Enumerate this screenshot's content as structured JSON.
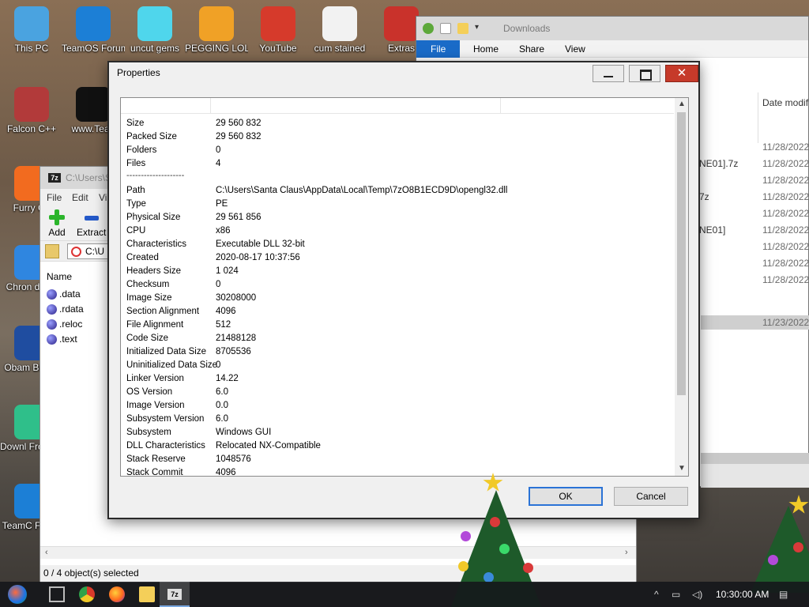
{
  "desktop": {
    "icons": [
      {
        "label": "This PC",
        "color": "#4aa3e0"
      },
      {
        "label": "TeamOS Forum Lin",
        "color": "#1c7fd6"
      },
      {
        "label": "uncut gems",
        "color": "#4fd6ec"
      },
      {
        "label": "PEGGING LOL",
        "color": "#f0a126"
      },
      {
        "label": "YouTube",
        "color": "#d63a2b"
      },
      {
        "label": "cum stained",
        "color": "#f2f2f2"
      },
      {
        "label": "Extras",
        "color": "#c9322b"
      },
      {
        "label": "Falcon C++",
        "color": "#b23a3a"
      },
      {
        "label": "www.Tean",
        "color": "#111111"
      },
      {
        "label": "Furry Co",
        "color": "#f26b1f"
      },
      {
        "label": "Chron disea",
        "color": "#2f86e0"
      },
      {
        "label": "Obam Brows",
        "color": "#1f4da0"
      },
      {
        "label": "Downl From tea",
        "color": "#2fbf8a"
      },
      {
        "label": "TeamC Faceb",
        "color": "#1c7fd6"
      }
    ]
  },
  "explorer": {
    "title": "Downloads",
    "tabs": [
      "File",
      "Home",
      "Share",
      "View"
    ],
    "column_header": "Date modif",
    "rows": [
      {
        "name": "",
        "date": "11/28/2022"
      },
      {
        "name": "NE01].7z",
        "date": "11/28/2022"
      },
      {
        "name": "",
        "date": "11/28/2022"
      },
      {
        "name": "7z",
        "date": "11/28/2022"
      },
      {
        "name": "",
        "date": "11/28/2022"
      },
      {
        "name": "NE01]",
        "date": "11/28/2022"
      },
      {
        "name": "",
        "date": "11/28/2022"
      },
      {
        "name": "",
        "date": "11/28/2022"
      },
      {
        "name": "",
        "date": "11/28/2022"
      },
      {
        "name": "",
        "date": "11/23/2022"
      }
    ]
  },
  "sevenzip": {
    "badge": "7z",
    "title_path": "C:\\Users\\S",
    "menu": [
      "File",
      "Edit",
      "Vi"
    ],
    "toolbar": {
      "add": "Add",
      "extract": "Extract"
    },
    "address": "C:\\U",
    "list_header": "Name",
    "files": [
      ".data",
      ".rdata",
      ".reloc",
      ".text"
    ],
    "status": "0 / 4 object(s) selected"
  },
  "dialog": {
    "title": "Properties",
    "close_glyph": "✕",
    "separator": "--------------------",
    "rows_top": [
      {
        "k": "Size",
        "v": "29 560 832"
      },
      {
        "k": "Packed Size",
        "v": "29 560 832"
      },
      {
        "k": "Folders",
        "v": "0"
      },
      {
        "k": "Files",
        "v": "4"
      }
    ],
    "rows": [
      {
        "k": "Path",
        "v": "C:\\Users\\Santa Claus\\AppData\\Local\\Temp\\7zO8B1ECD9D\\opengl32.dll"
      },
      {
        "k": "Type",
        "v": "PE"
      },
      {
        "k": "Physical Size",
        "v": "29 561 856"
      },
      {
        "k": "CPU",
        "v": "x86"
      },
      {
        "k": "Characteristics",
        "v": "Executable DLL 32-bit"
      },
      {
        "k": "Created",
        "v": "2020-08-17 10:37:56"
      },
      {
        "k": "Headers Size",
        "v": "1 024"
      },
      {
        "k": "Checksum",
        "v": "0"
      },
      {
        "k": "Image Size",
        "v": "30208000"
      },
      {
        "k": "Section Alignment",
        "v": "4096"
      },
      {
        "k": "File Alignment",
        "v": "512"
      },
      {
        "k": "Code Size",
        "v": "21488128"
      },
      {
        "k": "Initialized Data Size",
        "v": "8705536"
      },
      {
        "k": "Uninitialized Data Size",
        "v": "0"
      },
      {
        "k": "Linker Version",
        "v": "14.22"
      },
      {
        "k": "OS Version",
        "v": "6.0"
      },
      {
        "k": "Image Version",
        "v": "0.0"
      },
      {
        "k": "Subsystem Version",
        "v": "6.0"
      },
      {
        "k": "Subsystem",
        "v": "Windows GUI"
      },
      {
        "k": "DLL Characteristics",
        "v": "Relocated NX-Compatible"
      },
      {
        "k": "Stack Reserve",
        "v": "1048576"
      },
      {
        "k": "Stack Commit",
        "v": "4096"
      }
    ],
    "ok_label": "OK",
    "cancel_label": "Cancel"
  },
  "taskbar": {
    "time": "10:30:00 AM",
    "apps": [
      "task-view",
      "chrome",
      "firefox",
      "file-explorer",
      "7-zip"
    ]
  }
}
